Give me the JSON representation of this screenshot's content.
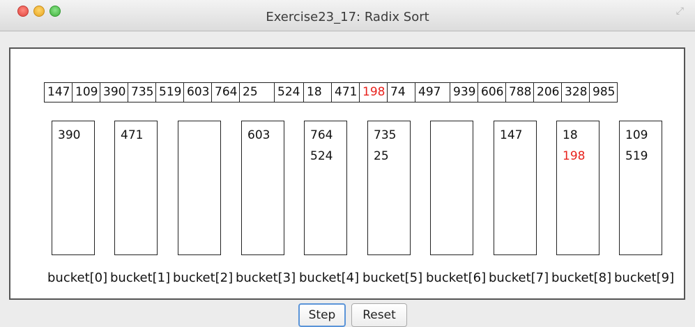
{
  "window": {
    "title": "Exercise23_17: Radix Sort",
    "fullscreen_icon": "fullscreen-arrows-icon"
  },
  "array": {
    "values": [
      "147",
      "109",
      "390",
      "735",
      "519",
      "603",
      "764",
      "25",
      "524",
      "18",
      "471",
      "198",
      "74",
      "497",
      "939",
      "606",
      "788",
      "206",
      "328",
      "985"
    ],
    "highlight_index": 11
  },
  "buckets": [
    {
      "label": "bucket[0]",
      "values": [
        "390"
      ]
    },
    {
      "label": "bucket[1]",
      "values": [
        "471"
      ]
    },
    {
      "label": "bucket[2]",
      "values": []
    },
    {
      "label": "bucket[3]",
      "values": [
        "603"
      ]
    },
    {
      "label": "bucket[4]",
      "values": [
        "764",
        "524"
      ]
    },
    {
      "label": "bucket[5]",
      "values": [
        "735",
        "25"
      ]
    },
    {
      "label": "bucket[6]",
      "values": []
    },
    {
      "label": "bucket[7]",
      "values": [
        "147"
      ]
    },
    {
      "label": "bucket[8]",
      "values": [
        "18",
        "198"
      ],
      "highlight_value": "198"
    },
    {
      "label": "bucket[9]",
      "values": [
        "109",
        "519"
      ]
    }
  ],
  "buttons": {
    "step_label": "Step",
    "reset_label": "Reset"
  },
  "colors": {
    "highlight": "#e8231e",
    "focus_ring": "#5a94d8"
  }
}
